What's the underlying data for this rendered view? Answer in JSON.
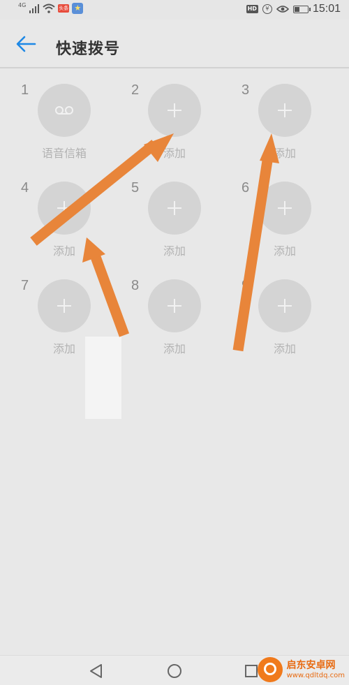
{
  "status_bar": {
    "network": "4G",
    "badge_red": "头条",
    "time": "15:01",
    "hd": "HD"
  },
  "app_bar": {
    "title": "快速拨号"
  },
  "speed_dial": [
    {
      "number": "1",
      "label": "语音信箱",
      "icon": "voicemail-icon"
    },
    {
      "number": "2",
      "label": "添加",
      "icon": "plus-icon"
    },
    {
      "number": "3",
      "label": "添加",
      "icon": "plus-icon"
    },
    {
      "number": "4",
      "label": "添加",
      "icon": "plus-icon"
    },
    {
      "number": "5",
      "label": "添加",
      "icon": "plus-icon"
    },
    {
      "number": "6",
      "label": "添加",
      "icon": "plus-icon"
    },
    {
      "number": "7",
      "label": "添加",
      "icon": "plus-icon"
    },
    {
      "number": "8",
      "label": "添加",
      "icon": "plus-icon"
    },
    {
      "number": "9",
      "label": "添加",
      "icon": "plus-icon"
    }
  ],
  "watermark": {
    "name": "启东安卓网",
    "url": "www.qdltdq.com"
  },
  "colors": {
    "accent_back": "#1e88e5",
    "annotation_arrow": "#e8853a",
    "circle": "#d4d4d4"
  }
}
